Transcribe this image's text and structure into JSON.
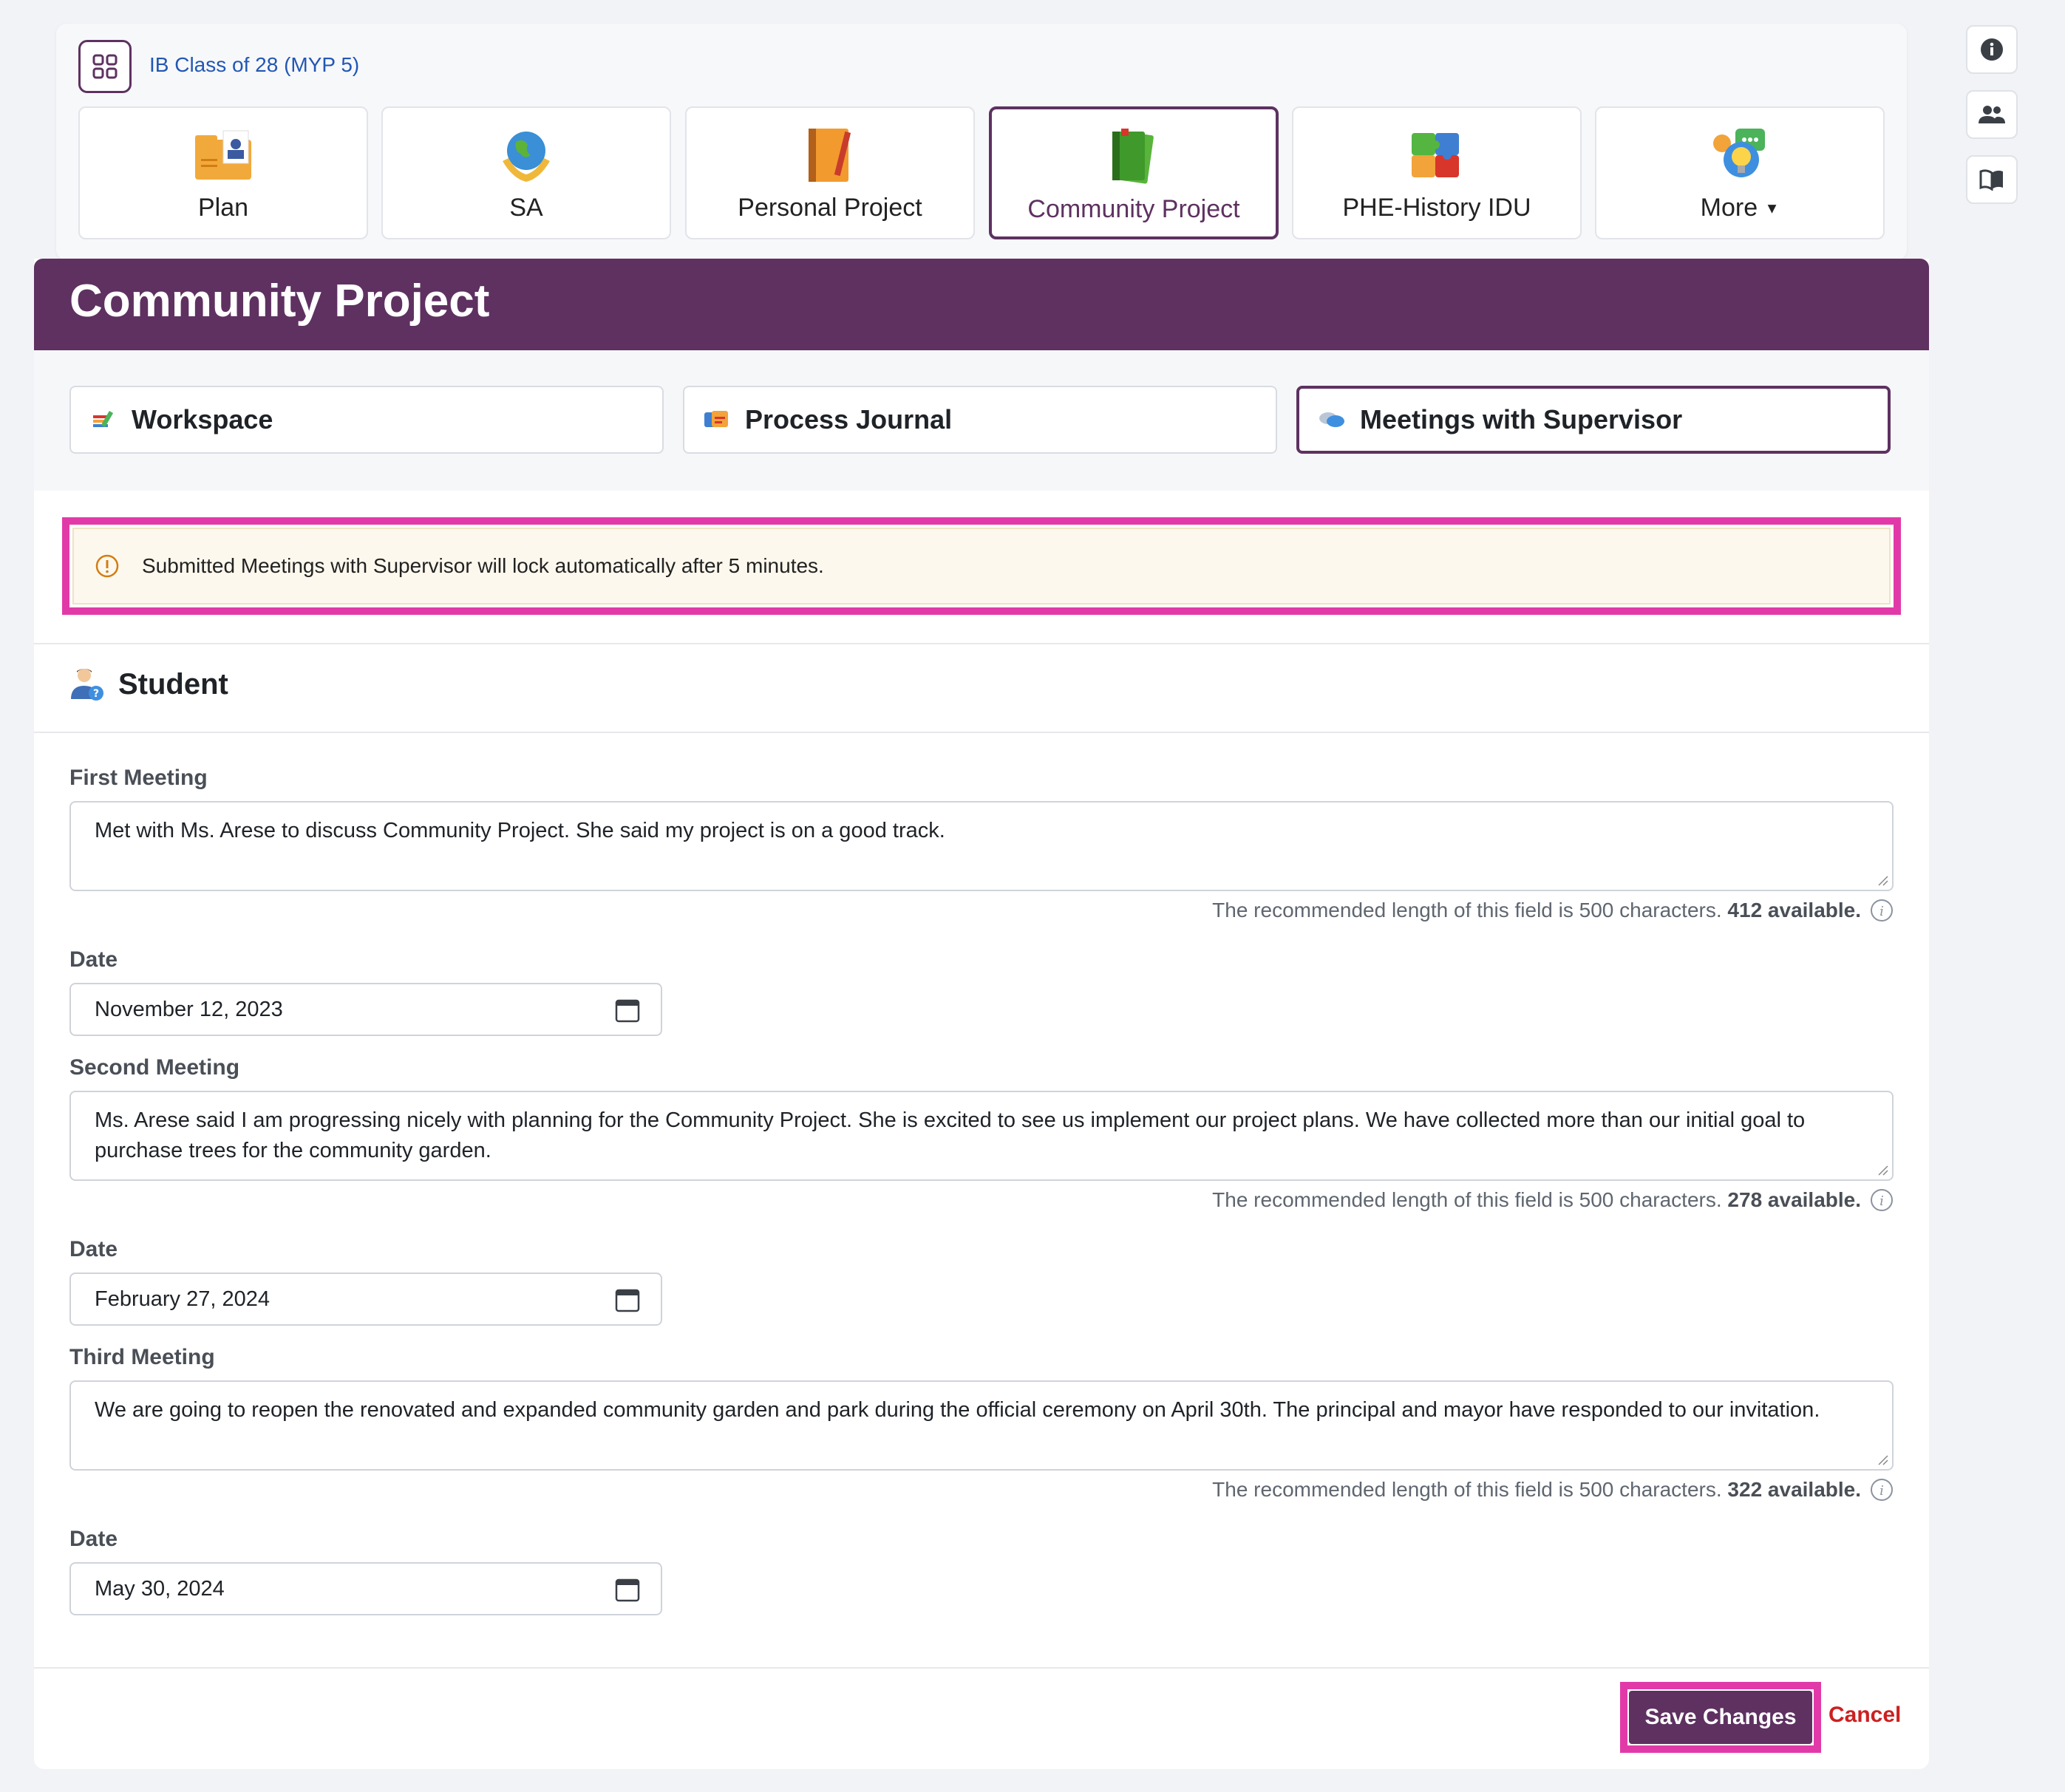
{
  "class_link": "IB Class of 28 (MYP 5)",
  "tiles": [
    {
      "label": "Plan",
      "icon": "plan-folder-icon"
    },
    {
      "label": "SA",
      "icon": "globe-hands-icon"
    },
    {
      "label": "Personal Project",
      "icon": "notebook-pencil-icon"
    },
    {
      "label": "Community Project",
      "icon": "green-books-icon"
    },
    {
      "label": "PHE-History IDU",
      "icon": "puzzle-icon"
    },
    {
      "label": "More",
      "icon": "lightbulb-chat-icon"
    }
  ],
  "page_title": "Community Project",
  "subtabs": [
    {
      "label": "Workspace",
      "icon": "workspace-icon"
    },
    {
      "label": "Process Journal",
      "icon": "journal-icon"
    },
    {
      "label": "Meetings with Supervisor",
      "icon": "speech-bubbles-icon"
    }
  ],
  "alert": "Submitted Meetings with Supervisor will lock automatically after 5 minutes.",
  "section_title": "Student",
  "meetings": [
    {
      "label": "First Meeting",
      "text": "Met with Ms. Arese to discuss Community Project. She said my project is on a good track.",
      "hint": "The recommended length of this field is 500 characters.",
      "available": "412 available.",
      "date_label": "Date",
      "date": "November 12, 2023"
    },
    {
      "label": "Second Meeting",
      "text": "Ms. Arese said I am progressing nicely with planning for the Community Project. She is excited to see us implement our project plans. We have collected more than our initial goal to purchase trees for the community garden.",
      "hint": "The recommended length of this field is 500 characters.",
      "available": "278 available.",
      "date_label": "Date",
      "date": "February 27, 2024"
    },
    {
      "label": "Third Meeting",
      "text": "We are going to reopen the renovated and expanded community garden and park during the official ceremony on April 30th. The principal and mayor have responded to our invitation.",
      "hint": "The recommended length of this field is 500 characters.",
      "available": "322 available.",
      "date_label": "Date",
      "date": "May 30, 2024"
    }
  ],
  "buttons": {
    "save": "Save Changes",
    "cancel": "Cancel"
  },
  "colors": {
    "brand": "#5e3161",
    "highlight": "#e13aa8",
    "cancel": "#cc2020",
    "link": "#2257b5"
  }
}
